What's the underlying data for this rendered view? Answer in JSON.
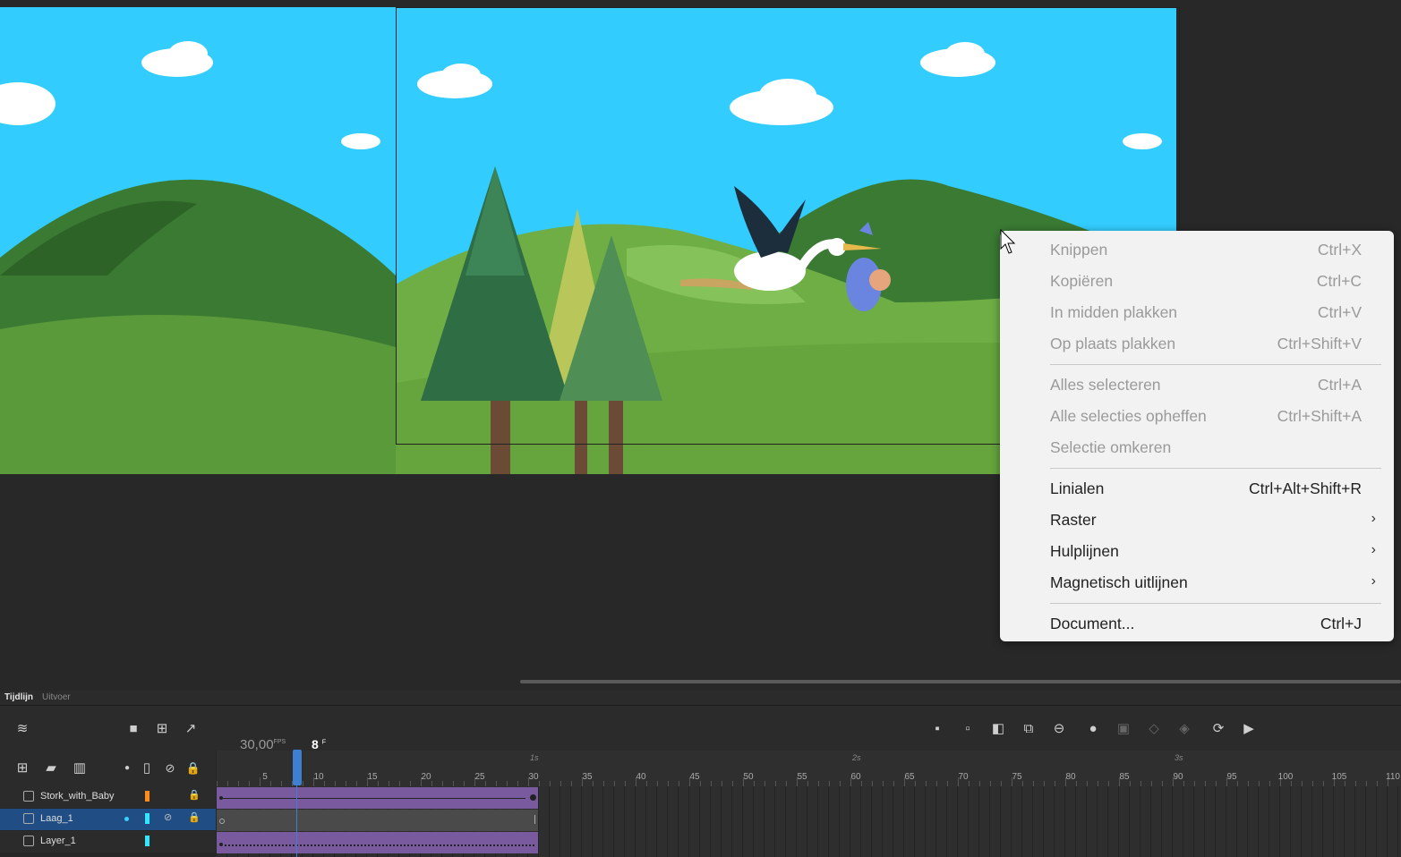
{
  "colors": {
    "sky": "#33ccff",
    "menu_bg": "#f2f2f2",
    "layer_span": "#7a5a9e",
    "playhead": "#3d7fd0",
    "selected_layer": "#1f4d84"
  },
  "context_menu": {
    "items": [
      {
        "label": "Knippen",
        "shortcut": "Ctrl+X",
        "enabled": false
      },
      {
        "label": "Kopiëren",
        "shortcut": "Ctrl+C",
        "enabled": false
      },
      {
        "label": "In midden plakken",
        "shortcut": "Ctrl+V",
        "enabled": false
      },
      {
        "label": "Op plaats plakken",
        "shortcut": "Ctrl+Shift+V",
        "enabled": false
      },
      {
        "label": "Alles selecteren",
        "shortcut": "Ctrl+A",
        "enabled": false
      },
      {
        "label": "Alle selecties opheffen",
        "shortcut": "Ctrl+Shift+A",
        "enabled": false
      },
      {
        "label": "Selectie omkeren",
        "shortcut": "",
        "enabled": false
      },
      {
        "label": "Linialen",
        "shortcut": "Ctrl+Alt+Shift+R",
        "enabled": true
      },
      {
        "label": "Raster",
        "shortcut": "",
        "enabled": true,
        "submenu": true
      },
      {
        "label": "Hulplijnen",
        "shortcut": "",
        "enabled": true,
        "submenu": true
      },
      {
        "label": "Magnetisch uitlijnen",
        "shortcut": "",
        "enabled": true,
        "submenu": true
      },
      {
        "label": "Document...",
        "shortcut": "Ctrl+J",
        "enabled": true
      }
    ],
    "submenu_glyph": "›"
  },
  "timeline": {
    "tabs": [
      "Tijdlijn",
      "Uitvoer"
    ],
    "fps": "30,00",
    "fps_unit": "FPS",
    "current_frame": "8",
    "frame_unit": "F",
    "current_frame_value": 8,
    "frame_numbers": [
      5,
      10,
      15,
      20,
      25,
      30,
      35,
      40,
      45,
      50,
      55,
      60,
      65,
      70,
      75,
      80,
      85,
      90,
      95,
      100,
      105,
      110
    ],
    "seconds": [
      {
        "label": "1s",
        "frame": 30
      },
      {
        "label": "2s",
        "frame": 60
      },
      {
        "label": "3s",
        "frame": 90
      }
    ],
    "layers": [
      {
        "name": "Stork_with_Baby",
        "color": "#ff8c1a",
        "selected": false,
        "locked": true,
        "span_color": "#7a5a9e"
      },
      {
        "name": "Laag_1",
        "color": "#33e6ff",
        "selected": true,
        "locked": true,
        "span_color": "#4a4a4a"
      },
      {
        "name": "Layer_1",
        "color": "#33e6ff",
        "selected": false,
        "locked": false,
        "span_color": "#7a5a9e"
      }
    ]
  }
}
